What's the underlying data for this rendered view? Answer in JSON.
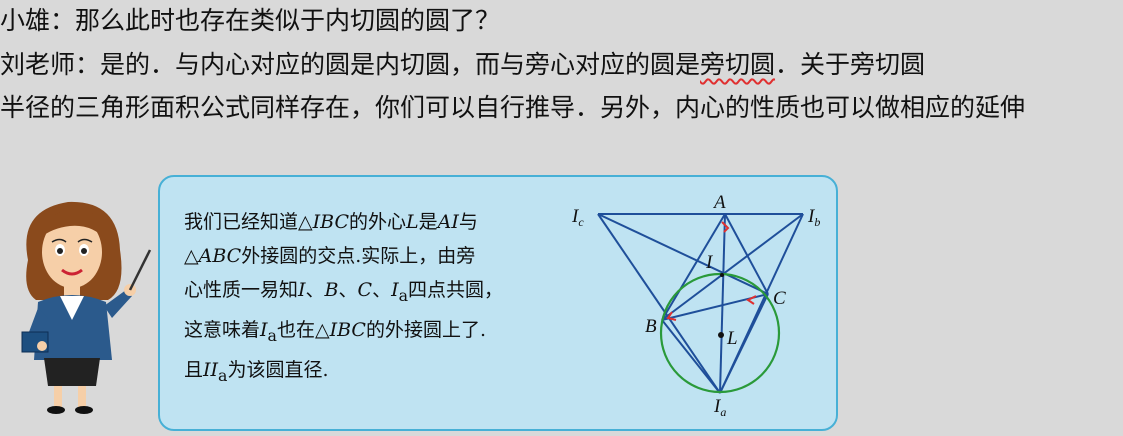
{
  "dialog": {
    "line1": "小雄：那么此时也存在类似于内切圆的圆了？",
    "line2_before": "刘老师：是的．与内心对应的圆是内切圆，而与旁心对应的圆是",
    "line2_term": "旁切圆",
    "line2_after": "．关于旁切圆",
    "line3": "半径的三角形面积公式同样存在，你们可以自行推导．另外，内心的性质也可以做相应的延伸"
  },
  "card": {
    "row1_a": "我们已经知道△",
    "row1_b": "IBC",
    "row1_c": "的外心",
    "row1_d": "L",
    "row1_e": "是",
    "row1_f": "AI",
    "row1_g": "与",
    "row2_a": "△",
    "row2_b": "ABC",
    "row2_c": "外接圆的交点.实际上，由旁",
    "row3_a": "心性质一易知",
    "row3_b": "I",
    "row3_c": "、",
    "row3_d": "B",
    "row3_e": "、",
    "row3_f": "C",
    "row3_g": "、",
    "row3_h": "I",
    "row3_sub": "a",
    "row3_i": "四点共圆，",
    "row4_a": "这意味着",
    "row4_b": "I",
    "row4_sub": "a",
    "row4_c": "也在△",
    "row4_d": "IBC",
    "row4_e": "的外接圆上了.",
    "row5_a": "且",
    "row5_b": "II",
    "row5_sub": "a",
    "row5_c": "为该圆直径."
  },
  "diagram": {
    "labels": {
      "A": "A",
      "I": "I",
      "B": "B",
      "C": "C",
      "L": "L",
      "Ic": "I",
      "Ic_sub": "c",
      "Ib": "I",
      "Ib_sub": "b",
      "Ia": "I",
      "Ia_sub": "a"
    },
    "colors": {
      "lines": "#1f4f9a",
      "circle": "#2a9a3a",
      "marks": "#e03030"
    }
  }
}
